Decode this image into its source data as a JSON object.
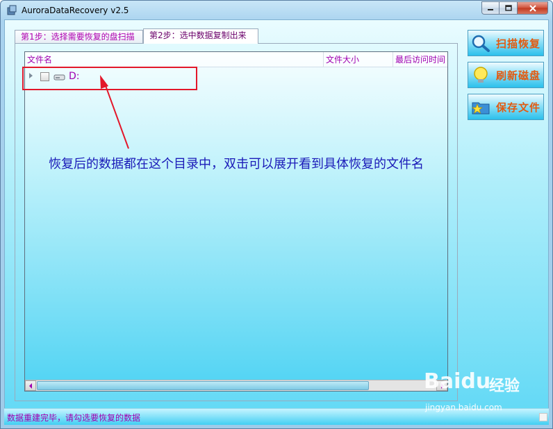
{
  "window": {
    "title": "AuroraDataRecovery v2.5"
  },
  "tabs": [
    {
      "label": "第1步：选择需要恢复的盘扫描",
      "selected": false
    },
    {
      "label": "第2步：选中数据复制出来",
      "selected": true
    }
  ],
  "tree": {
    "columns": [
      "文件名",
      "文件大小",
      "最后访问时间"
    ],
    "rows": [
      {
        "label": "D:",
        "checked": false
      }
    ]
  },
  "annotation": {
    "text": "恢复后的数据都在这个目录中，双击可以展开看到具体恢复的文件名",
    "color": "#e3172a"
  },
  "actions": [
    {
      "label": "扫描恢复",
      "icon": "magnifier-icon"
    },
    {
      "label": "刷新磁盘",
      "icon": "lightbulb-icon"
    },
    {
      "label": "保存文件",
      "icon": "folder-star-icon"
    }
  ],
  "status": {
    "text": "数据重建完毕，请勾选要恢复的数据"
  },
  "watermark": {
    "logo": "Baidu",
    "brand": "经验",
    "url": "jingyan.baidu.com"
  }
}
